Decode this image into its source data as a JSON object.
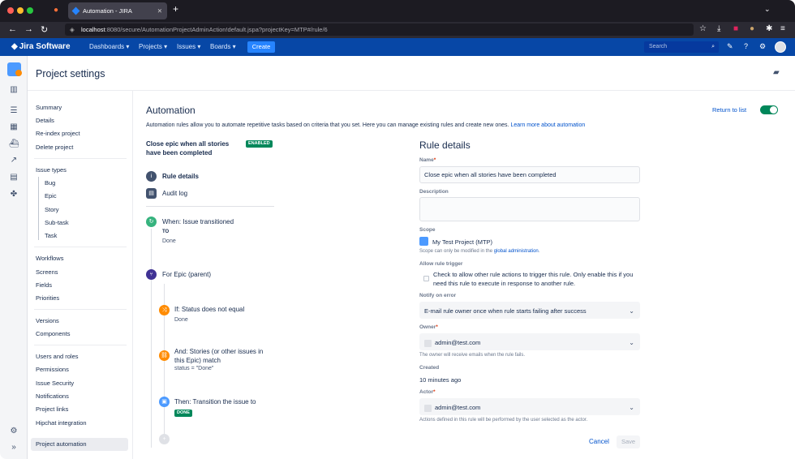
{
  "browser": {
    "tab_title": "Automation - JIRA",
    "url_host": "localhost",
    "url_rest": ":8080/secure/AutomationProjectAdminAction!default.jspa?projectKey=MTP#/rule/6"
  },
  "header": {
    "logo": "Jira Software",
    "nav": [
      "Dashboards",
      "Projects",
      "Issues",
      "Boards"
    ],
    "create_label": "Create",
    "search_placeholder": "Search"
  },
  "page": {
    "title": "Project settings"
  },
  "sidebar": {
    "groups": [
      [
        "Summary",
        "Details",
        "Re-index project",
        "Delete project"
      ],
      [
        "Issue types"
      ],
      [
        "Workflows",
        "Screens",
        "Fields",
        "Priorities"
      ],
      [
        "Versions",
        "Components"
      ],
      [
        "Users and roles",
        "Permissions",
        "Issue Security",
        "Notifications",
        "Project links",
        "Hipchat integration"
      ]
    ],
    "issue_types": [
      "Bug",
      "Epic",
      "Story",
      "Sub-task",
      "Task"
    ],
    "active": "Project automation"
  },
  "automation": {
    "heading": "Automation",
    "return_link": "Return to list",
    "description": "Automation rules allow you to automate repetitive tasks based on criteria that you set. Here you can manage existing rules and create new ones.",
    "learn_more": "Learn more about automation",
    "rule_name": "Close epic when all stories have been completed",
    "status_badge": "ENABLED",
    "steps": {
      "rule_details": "Rule details",
      "audit_log": "Audit log",
      "trigger": "When: Issue transitioned",
      "trigger_to_label": "TO",
      "trigger_to_value": "Done",
      "branch": "For Epic (parent)",
      "condition1": "If: Status does not equal",
      "condition1_value": "Done",
      "condition2_line1": "And: Stories (or other issues in",
      "condition2_line2": "this Epic) match",
      "condition2_value": "status = \"Done\"",
      "action": "Then: Transition the issue to",
      "action_value": "DONE"
    }
  },
  "rule_details": {
    "title": "Rule details",
    "name_label": "Name",
    "name_value": "Close epic when all stories have been completed",
    "description_label": "Description",
    "scope_label": "Scope",
    "scope_value": "My Test Project (MTP)",
    "scope_help": "Scope can only be modified in the",
    "scope_help_link": "global administration",
    "allow_label": "Allow rule trigger",
    "allow_text_1": "Check to allow other rule actions to trigger this rule. Only enable this if you",
    "allow_text_2": "need this rule to execute in response to another rule.",
    "notify_label": "Notify on error",
    "notify_value": "E-mail rule owner once when rule starts failing after success",
    "owner_label": "Owner",
    "owner_value": "admin@test.com",
    "owner_help": "The owner will receive emails when the rule fails.",
    "created_label": "Created",
    "created_value": "10 minutes ago",
    "actor_label": "Actor",
    "actor_value": "admin@test.com",
    "actor_help": "Actions defined in this rule will be performed by the user selected as the actor.",
    "cancel_label": "Cancel",
    "save_label": "Save"
  }
}
